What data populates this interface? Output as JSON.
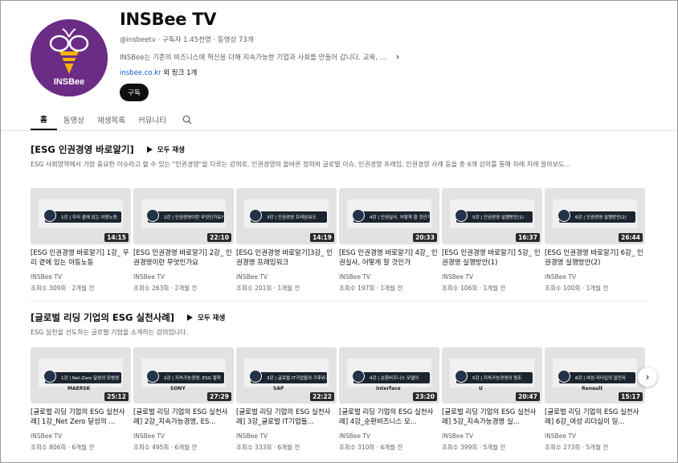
{
  "channel": {
    "name": "INSBee TV",
    "meta": "@insbeetv · 구독자 1.45천명 · 동영상 73개",
    "description": "INSBee는 기존의 비즈니스에 혁신을 더해 지속가능한 기업과 사회를 만들어 갑니다. 교육, ...",
    "link_url": "insbee.co.kr",
    "link_more": " 외 링크 1개",
    "subscribe_label": "구독",
    "avatar_text": "INSBee",
    "avatar_color": "#6b2c86"
  },
  "tabs": [
    {
      "label": "홈",
      "active": true
    },
    {
      "label": "동영상",
      "active": false
    },
    {
      "label": "재생목록",
      "active": false
    },
    {
      "label": "커뮤니티",
      "active": false
    }
  ],
  "sections": [
    {
      "title": "[ESG 인권경영 바로알기]",
      "play_all": "모두 재생",
      "description": "ESG 사회영역에서 가장 중요한 이슈라고 할 수 있는 \"인권경영\"을 다루는 강의로, 인권경영의 올바른 정의와 글로벌 이슈, 인권경영 프레임, 인권경영 사례 등을 총 6개 강의를 통해 차례 차례 알아보도...",
      "videos": [
        {
          "thumb_label": "1강 | 우리 곁에 있는 아동노동",
          "duration": "14:15",
          "title": "[ESG 인권경영 바로알기] 1강_ 우리 곁에 있는 아동노동",
          "channel": "INSBee TV",
          "meta": "조회수 309회 · 2개월 전"
        },
        {
          "thumb_label": "2강 | 인권경영이란 무엇인가요?",
          "duration": "22:10",
          "title": "[ESG 인권경영 바로알기] 2강_ 인권경영이란 무엇인가요",
          "channel": "INSBee TV",
          "meta": "조회수 263회 · 2개월 전"
        },
        {
          "thumb_label": "3강 | 인권경영 프레임워크",
          "duration": "14:19",
          "title": "[ESG 인권경영 바로알기]3강_ 인권경영 프레임워크",
          "channel": "INSBee TV",
          "meta": "조회수 201회 · 1개월 전"
        },
        {
          "thumb_label": "4강 | 인권실사, 어떻게 할 것인가?",
          "duration": "20:33",
          "title": "[ESG 인권경영 바로알기] 4강_ 인권실사, 어떻게 할 것인가",
          "channel": "INSBee TV",
          "meta": "조회수 197회 · 1개월 전"
        },
        {
          "thumb_label": "5강 | 인권경영 실행방안(1)",
          "duration": "16:37",
          "title": "[ESG 인권경영 바로알기] 5강_ 인권경영 실행방안(1)",
          "channel": "INSBee TV",
          "meta": "조회수 106회 · 1개월 전"
        },
        {
          "thumb_label": "6강 | 인권경영 실행방안(2)",
          "duration": "26:44",
          "title": "[ESG 인권경영 바로알기] 6강_ 인권경영 실행방안(2)",
          "channel": "INSBee TV",
          "meta": "조회수 100회 · 1개월 전"
        }
      ]
    },
    {
      "title": "[글로벌 리딩 기업의 ESG 실천사례]",
      "play_all": "모두 재생",
      "description": "ESG 실천을 선도하는 글로벌 기업을 소개하는 강의입니다.",
      "videos": [
        {
          "thumb_label": "1강 | Net-Zero 달성의 모범생",
          "brand": "MAERSK",
          "duration": "25:12",
          "title": "[글로벌 리딩 기업의 ESG 실천사례] 1강_Net Zero 달성의 ...",
          "channel": "INSBee TV",
          "meta": "조회수 806회 · 6개월 전"
        },
        {
          "thumb_label": "2강 | 지속가능경영, ESG 철학",
          "brand": "SONY",
          "duration": "27:29",
          "title": "[글로벌 리딩 기업의 ESG 실천사례] 2강_지속가능경영, ES...",
          "channel": "INSBee TV",
          "meta": "조회수 495회 · 6개월 전"
        },
        {
          "thumb_label": "3강 | 글로벌 IT기업들의 기후위기",
          "brand": "SAP",
          "duration": "22:22",
          "title": "[글로벌 리딩 기업의 ESG 실천사례] 3강_글로벌 IT기업들...",
          "channel": "INSBee TV",
          "meta": "조회수 333회 · 6개월 전"
        },
        {
          "thumb_label": "4강 | 순환비즈니스 모델의",
          "brand": "Interface",
          "duration": "23:20",
          "title": "[글로벌 리딩 기업의 ESG 실천사례] 4강_순환비즈니스 모...",
          "channel": "INSBee TV",
          "meta": "조회수 310회 · 6개월 전"
        },
        {
          "thumb_label": "5강 | 지속가능경영의 원조",
          "brand": "U",
          "duration": "20:47",
          "title": "[글로벌 리딩 기업의 ESG 실천사례] 5강_지속가능경영 실...",
          "channel": "INSBee TV",
          "meta": "조회수 399회 · 5개월 전"
        },
        {
          "thumb_label": "6강 | 여성 리더십의 일인자",
          "brand": "Renault",
          "duration": "15:17",
          "title": "[글로벌 리딩 기업의 ESG 실천사례] 6강_여성 리더십이 일...",
          "channel": "INSBee TV",
          "meta": "조회수 273회 · 5개월 전"
        }
      ]
    }
  ]
}
